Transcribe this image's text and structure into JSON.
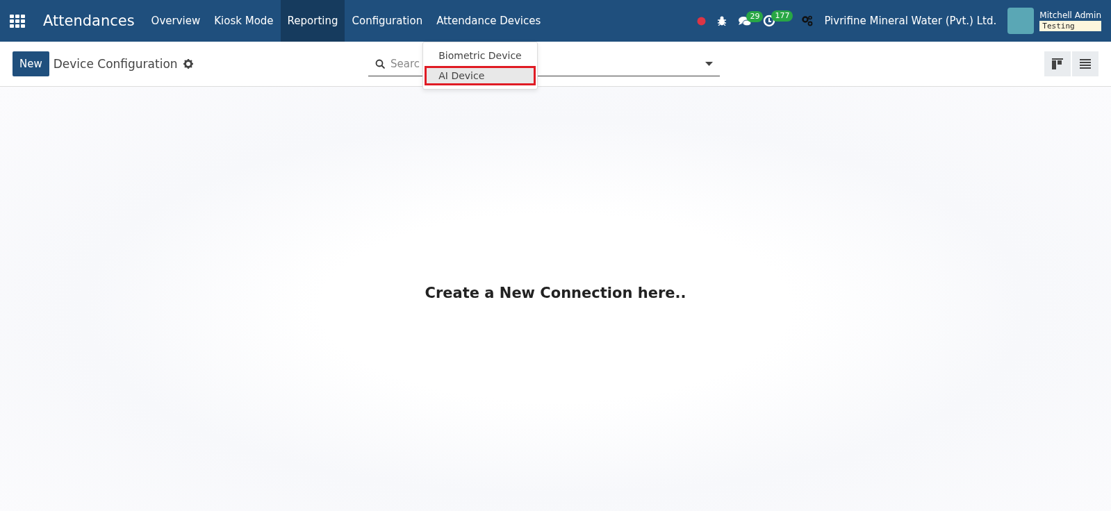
{
  "navbar": {
    "app_title": "Attendances",
    "menu": [
      {
        "label": "Overview",
        "selected": false
      },
      {
        "label": "Kiosk Mode",
        "selected": false
      },
      {
        "label": "Reporting",
        "selected": true
      },
      {
        "label": "Configuration",
        "selected": false
      },
      {
        "label": "Attendance Devices",
        "selected": false,
        "dropdown": [
          {
            "label": "Biometric Device",
            "selected": false
          },
          {
            "label": "AI Device",
            "selected": true
          }
        ]
      }
    ],
    "messages_count": "29",
    "activities_count": "177",
    "company": "Pivrifine Mineral Water (Pvt.) Ltd.",
    "user": "Mitchell Admin",
    "database": "Testing"
  },
  "control_panel": {
    "new_button": "New",
    "title": "Device Configuration",
    "search": {
      "placeholder": "Searc"
    },
    "views": [
      {
        "kind": "kanban",
        "selected": false
      },
      {
        "kind": "list",
        "selected": false
      }
    ]
  },
  "empty_message": "Create a New Connection here.."
}
